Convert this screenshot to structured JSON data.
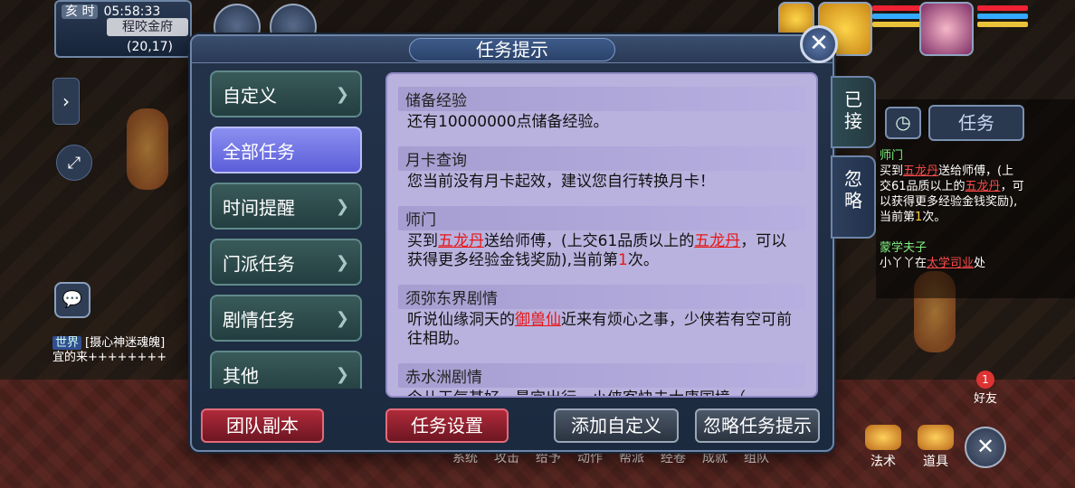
{
  "hud": {
    "era": "亥 时",
    "time": "05:58:33",
    "place": "程咬金府",
    "coord": "(20,17)"
  },
  "chat": {
    "channel": "世界",
    "line1": "[摄心神迷魂魄]",
    "line2": "宜的来++++++++"
  },
  "dialog": {
    "title": "任务提示",
    "categories": [
      {
        "label": "自定义"
      },
      {
        "label": "全部任务"
      },
      {
        "label": "时间提醒"
      },
      {
        "label": "门派任务"
      },
      {
        "label": "剧情任务"
      },
      {
        "label": "其他"
      }
    ],
    "side_tabs": {
      "accepted": "已接",
      "ignored": "忽略"
    },
    "entries": [
      {
        "title": "储备经验",
        "body": "还有10000000点储备经验。"
      },
      {
        "title": "月卡查询",
        "body": "您当前没有月卡起效，建议您自行转换月卡！"
      },
      {
        "title": "师门",
        "pre": "买到",
        "link1": "五龙丹",
        "mid": "送给师傅，(上交61品质以上的",
        "link2": "五龙丹",
        "post": "，可以获得更多经验金钱奖励),当前第",
        "count": "1",
        "tail": "次。"
      },
      {
        "title": "须弥东界剧情",
        "pre": "听说仙缘洞天的",
        "link1": "御兽仙",
        "post": "近来有烦心之事，少侠若有空可前往相助。"
      },
      {
        "title": "赤水洲剧情",
        "body": "今儿天气甚好，最宜出行。小侠客快去大唐国境（"
      }
    ],
    "buttons": {
      "team": "团队副本",
      "settings": "任务设置",
      "add_custom": "添加自定义",
      "ignore": "忽略任务提示"
    }
  },
  "right_panel": {
    "task_label": "任务",
    "head": "师门",
    "text_pre": "买到",
    "link1": "五龙丹",
    "text_mid": "送给师傅，(上交61品质以上的",
    "link2": "五龙丹",
    "text_post": "，可以获得更多经验金钱奖励),当前第",
    "count": "1",
    "tail": "次。",
    "head2": "蒙学夫子",
    "text2": "小丫丫在",
    "link3": "太学司业",
    "text2b": "处"
  },
  "toolbar": {
    "items": [
      "系统",
      "攻击",
      "给予",
      "动作",
      "帮派",
      "经卷",
      "成就",
      "组队"
    ],
    "fashu": "法术",
    "daoju": "道具",
    "friends": "好友",
    "friend_badge": "1"
  }
}
